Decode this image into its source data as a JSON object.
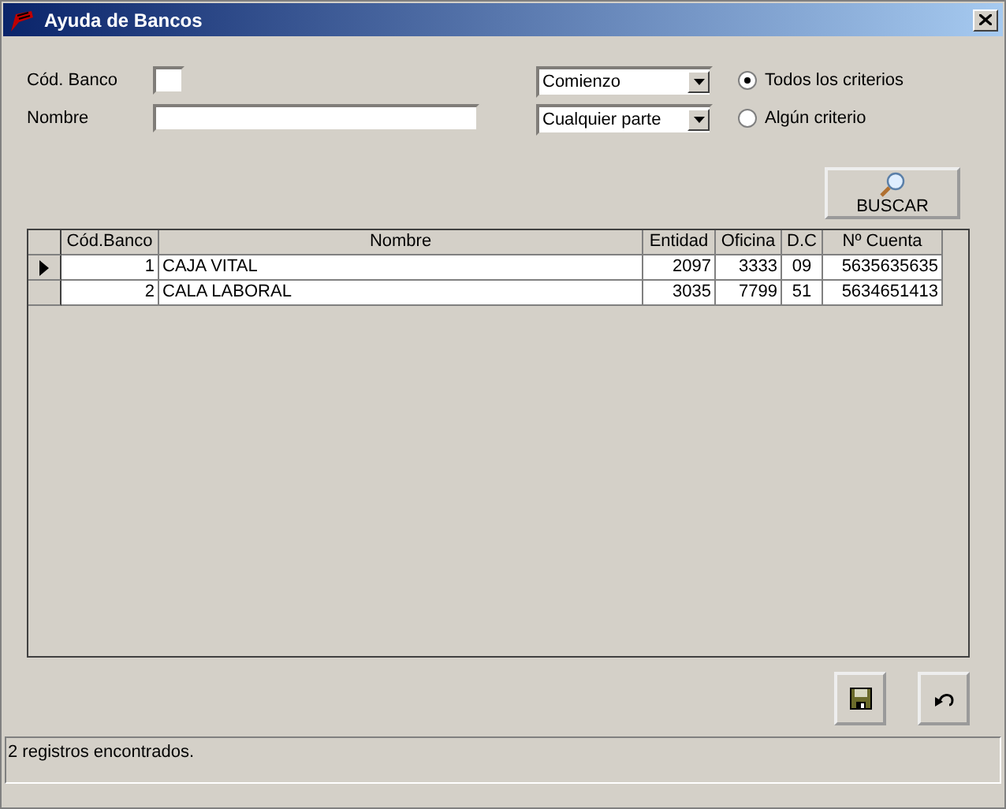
{
  "window": {
    "title": "Ayuda de Bancos"
  },
  "filters": {
    "code_label": "Cód. Banco",
    "name_label": "Nombre"
  },
  "dropdowns": [
    {
      "value": "Comienzo"
    },
    {
      "value": "Cualquier parte"
    }
  ],
  "criteria": [
    {
      "label": "Todos los criterios",
      "selected": true
    },
    {
      "label": "Algún criterio",
      "selected": false
    }
  ],
  "search_button": "BUSCAR",
  "table": {
    "columns": [
      "Cód.Banco",
      "Nombre",
      "Entidad",
      "Oficina",
      "D.C",
      "Nº Cuenta"
    ],
    "rows": [
      {
        "selected": true,
        "cells": [
          "1",
          "CAJA VITAL",
          "2097",
          "3333",
          "09",
          "5635635635"
        ]
      },
      {
        "selected": false,
        "cells": [
          "2",
          "CALA LABORAL",
          "3035",
          "7799",
          "51",
          "5634651413"
        ]
      }
    ]
  },
  "status_bar": "2 registros encontrados."
}
